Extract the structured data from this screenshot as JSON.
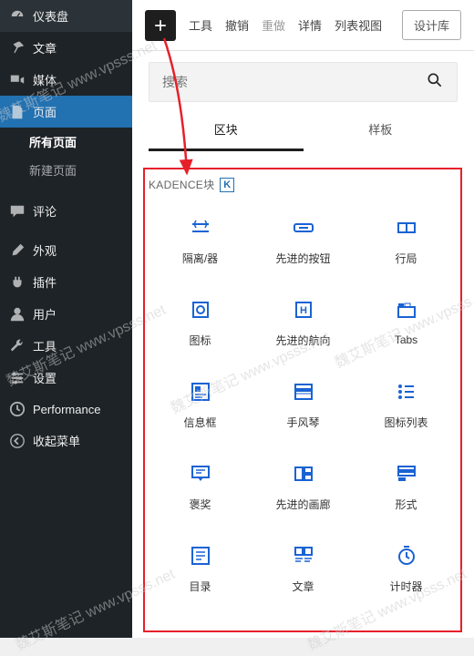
{
  "sidebar": {
    "items": [
      {
        "label": "仪表盘"
      },
      {
        "label": "文章"
      },
      {
        "label": "媒体"
      },
      {
        "label": "页面"
      },
      {
        "label": "评论"
      },
      {
        "label": "外观"
      },
      {
        "label": "插件"
      },
      {
        "label": "用户"
      },
      {
        "label": "工具"
      },
      {
        "label": "设置"
      },
      {
        "label": "Performance"
      },
      {
        "label": "收起菜单"
      }
    ],
    "sub": {
      "all": "所有页面",
      "new": "新建页面"
    }
  },
  "toolbar": {
    "tools": "工具",
    "undo": "撤销",
    "redo": "重做",
    "details": "详情",
    "listview": "列表视图",
    "design": "设计库"
  },
  "panel": {
    "search_placeholder": "搜索",
    "tab_blocks": "区块",
    "tab_patterns": "样板",
    "category": "KADENCE块"
  },
  "blocks": {
    "r0": [
      {
        "label": "隔离/器"
      },
      {
        "label": "先进的按钮"
      },
      {
        "label": "行局"
      }
    ],
    "r1": [
      {
        "label": "图标"
      },
      {
        "label": "先进的航向"
      },
      {
        "label": "Tabs"
      }
    ],
    "r2": [
      {
        "label": "信息框"
      },
      {
        "label": "手风琴"
      },
      {
        "label": "图标列表"
      }
    ],
    "r3": [
      {
        "label": "褒奖"
      },
      {
        "label": "先进的画廊"
      },
      {
        "label": "形式"
      }
    ],
    "r4": [
      {
        "label": "目录"
      },
      {
        "label": "文章"
      },
      {
        "label": "计时器"
      }
    ]
  },
  "watermark": "魏艾斯笔记\nwww.vpsss.net"
}
